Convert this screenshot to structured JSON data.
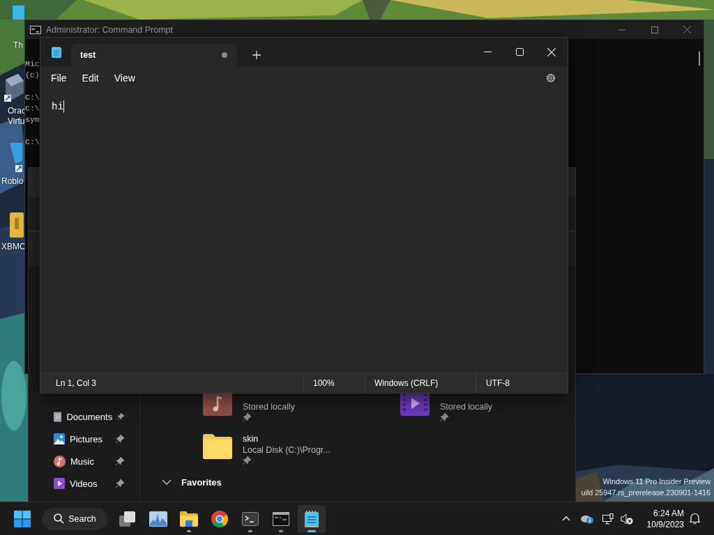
{
  "desktop": {
    "icons": [
      {
        "kind": "app",
        "lines": [
          "Th"
        ]
      },
      {
        "kind": "cube",
        "lines": [
          "Orac",
          "Virtu"
        ]
      },
      {
        "kind": "shortcut",
        "lines": [
          "Roblo"
        ]
      },
      {
        "kind": "archive",
        "lines": [
          "XBMC"
        ]
      }
    ],
    "watermark": [
      "Windows 11 Pro Insider Preview",
      "uild 25947.rs_prerelease.230901-1416"
    ]
  },
  "cmd_window": {
    "title": "Administrator: Command Prompt",
    "line_groups": [
      [
        "Mic",
        "(c)"
      ],
      [
        "C:\\",
        "C:\\",
        "sym"
      ],
      [
        "C:\\"
      ]
    ]
  },
  "explorer_window": {
    "sidebar": [
      {
        "kind": "documents",
        "label": "Documents",
        "pinned": true
      },
      {
        "kind": "pictures",
        "label": "Pictures",
        "pinned": true
      },
      {
        "kind": "music",
        "label": "Music",
        "pinned": true
      },
      {
        "kind": "videos",
        "label": "Videos",
        "pinned": true
      }
    ],
    "quick_access": [
      {
        "kind": "music",
        "subtitle": "Stored locally",
        "pinned": true
      },
      {
        "kind": "videos",
        "subtitle": "Stored locally",
        "pinned": true
      },
      {
        "kind": "folder",
        "name": "skin",
        "subtitle": "Local Disk (C:)\\Progr...",
        "pinned": true
      }
    ],
    "favorites": {
      "title": "Favorites",
      "expanded": true
    }
  },
  "notepad": {
    "tabs": [
      {
        "title": "test",
        "unsaved": true,
        "selected": true
      }
    ],
    "menu": [
      "File",
      "Edit",
      "View"
    ],
    "text": "hi",
    "status": {
      "position": "Ln 1, Col 3",
      "zoom": "100%",
      "line_ending": "Windows (CRLF)",
      "encoding": "UTF-8"
    }
  },
  "taskbar": {
    "search": "Search",
    "apps": [
      {
        "kind": "task-view",
        "running": false,
        "active": false
      },
      {
        "kind": "chart",
        "running": false,
        "active": false
      },
      {
        "kind": "folder",
        "running": true,
        "active": false
      },
      {
        "kind": "browser",
        "running": false,
        "active": false
      },
      {
        "kind": "terminal",
        "running": true,
        "active": false
      },
      {
        "kind": "console",
        "running": true,
        "active": false
      },
      {
        "kind": "notepad",
        "running": true,
        "active": true
      }
    ],
    "tray": {
      "time": "6:24 AM",
      "date": "10/9/2023"
    }
  }
}
